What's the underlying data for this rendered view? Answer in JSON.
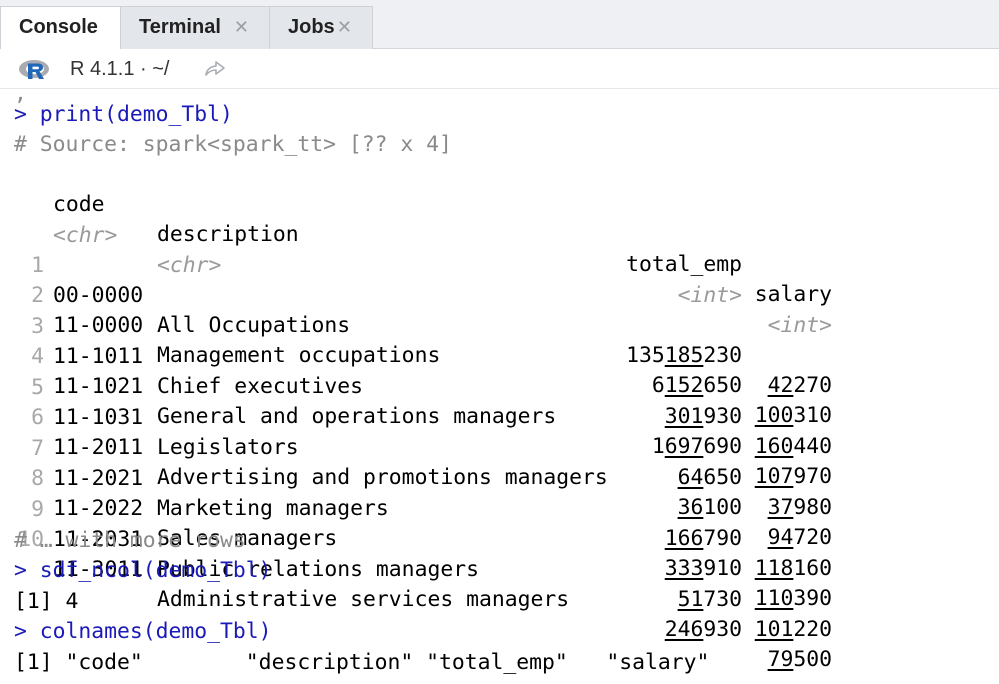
{
  "tabs": [
    {
      "label": "Console",
      "closable": false,
      "active": true
    },
    {
      "label": "Terminal",
      "closable": true,
      "active": false
    },
    {
      "label": "Jobs",
      "closable": true,
      "active": false
    }
  ],
  "path_bar": {
    "r_version": "R 4.1.1 · ~/",
    "icon": "r-logo-icon",
    "goto_icon": "goto-directory-icon"
  },
  "console": {
    "cmd1": "> print(demo_Tbl)",
    "source": "# Source: spark<spark_tt> [?? x 4]",
    "columns": [
      "code",
      "description",
      "total_emp",
      "salary"
    ],
    "types": [
      "<chr>",
      "<chr>",
      "<int>",
      "<int>"
    ],
    "rows": [
      {
        "n": "1",
        "code": "00-0000",
        "description": "All Occupations",
        "emp_a": "135",
        "emp_b": "185",
        "emp_c": "230",
        "sal_a": "",
        "sal_b": "42",
        "sal_c": "270"
      },
      {
        "n": "2",
        "code": "11-0000",
        "description": "Management occupations",
        "emp_a": "6",
        "emp_b": "152",
        "emp_c": "650",
        "sal_a": "",
        "sal_b": "100",
        "sal_c": "310"
      },
      {
        "n": "3",
        "code": "11-1011",
        "description": "Chief executives",
        "emp_a": "",
        "emp_b": "301",
        "emp_c": "930",
        "sal_a": "",
        "sal_b": "160",
        "sal_c": "440"
      },
      {
        "n": "4",
        "code": "11-1021",
        "description": "General and operations managers",
        "emp_a": "1",
        "emp_b": "697",
        "emp_c": "690",
        "sal_a": "",
        "sal_b": "107",
        "sal_c": "970"
      },
      {
        "n": "5",
        "code": "11-1031",
        "description": "Legislators",
        "emp_a": "",
        "emp_b": "64",
        "emp_c": "650",
        "sal_a": "",
        "sal_b": "37",
        "sal_c": "980"
      },
      {
        "n": "6",
        "code": "11-2011",
        "description": "Advertising and promotions managers",
        "emp_a": "",
        "emp_b": "36",
        "emp_c": "100",
        "sal_a": "",
        "sal_b": "94",
        "sal_c": "720"
      },
      {
        "n": "7",
        "code": "11-2021",
        "description": "Marketing managers",
        "emp_a": "",
        "emp_b": "166",
        "emp_c": "790",
        "sal_a": "",
        "sal_b": "118",
        "sal_c": "160"
      },
      {
        "n": "8",
        "code": "11-2022",
        "description": "Sales managers",
        "emp_a": "",
        "emp_b": "333",
        "emp_c": "910",
        "sal_a": "",
        "sal_b": "110",
        "sal_c": "390"
      },
      {
        "n": "9",
        "code": "11-2031",
        "description": "Public relations managers",
        "emp_a": "",
        "emp_b": "51",
        "emp_c": "730",
        "sal_a": "",
        "sal_b": "101",
        "sal_c": "220"
      },
      {
        "n": "10",
        "code": "11-3011",
        "description": "Administrative services managers",
        "emp_a": "",
        "emp_b": "246",
        "emp_c": "930",
        "sal_a": "",
        "sal_b": "79",
        "sal_c": "500"
      }
    ],
    "more_rows": "# … with more rows",
    "cmd2": "> sdf_ncol(demo_Tbl)",
    "out2": "[1] 4",
    "cmd3": "> colnames(demo_Tbl)",
    "out3": "[1] \"code\"        \"description\" \"total_emp\"   \"salary\""
  }
}
